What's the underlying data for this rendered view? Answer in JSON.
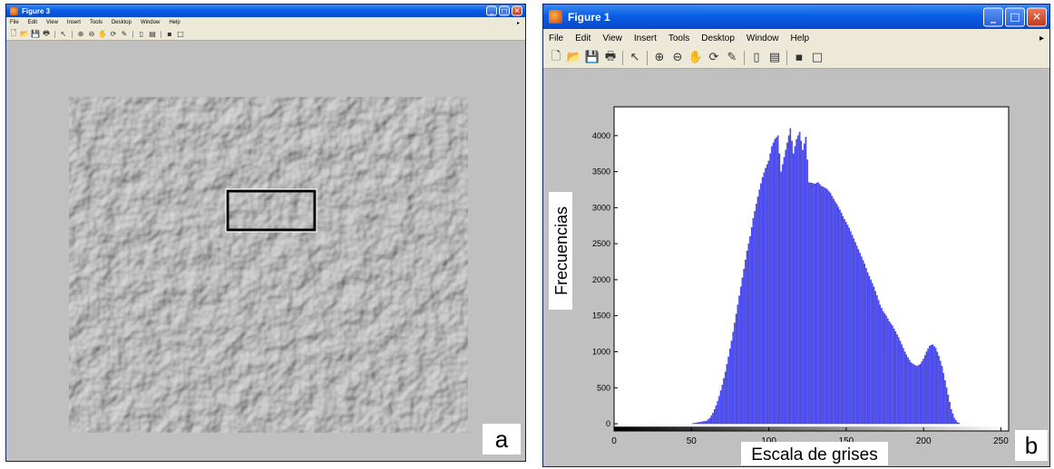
{
  "left_window": {
    "title": "Figure 3",
    "menu": [
      "File",
      "Edit",
      "View",
      "Insert",
      "Tools",
      "Desktop",
      "Window",
      "Help"
    ],
    "toolbar_icons": [
      "new-file-icon",
      "open-folder-icon",
      "save-icon",
      "print-icon",
      "pointer-icon",
      "zoom-in-icon",
      "zoom-out-icon",
      "pan-icon",
      "rotate-3d-icon",
      "data-cursor-icon",
      "colorbar-icon",
      "legend-icon",
      "hide-plot-tools-icon",
      "show-plot-tools-icon"
    ],
    "image": "grayscale leather texture",
    "panel_letter": "a"
  },
  "right_window": {
    "title": "Figure 1",
    "menu": [
      "File",
      "Edit",
      "View",
      "Insert",
      "Tools",
      "Desktop",
      "Window",
      "Help"
    ],
    "toolbar_icons": [
      "new-file-icon",
      "open-folder-icon",
      "save-icon",
      "print-icon",
      "pointer-icon",
      "zoom-in-icon",
      "zoom-out-icon",
      "pan-icon",
      "rotate-3d-icon",
      "data-cursor-icon",
      "colorbar-icon",
      "legend-icon",
      "hide-plot-tools-icon",
      "show-plot-tools-icon"
    ],
    "panel_letter": "b"
  },
  "colors": {
    "title_bar": "#0a5ee8",
    "figure_bg": "#c0c0c0",
    "bar_fill": "#5050ff"
  },
  "chart_data": {
    "type": "bar",
    "title": "",
    "xlabel": "Escala de grises",
    "ylabel": "Frecuencias",
    "xlim": [
      0,
      255
    ],
    "ylim": [
      -100,
      4400
    ],
    "xticks": [
      0,
      50,
      100,
      150,
      200,
      250
    ],
    "yticks": [
      0,
      500,
      1000,
      1500,
      2000,
      2500,
      3000,
      3500,
      4000
    ],
    "grid": false,
    "colorbar": "grayscale gradient 0 to 255 along x-axis",
    "series": [
      {
        "x": [
          0,
          10,
          20,
          30,
          40,
          50,
          55,
          60,
          62,
          64,
          66,
          68,
          70,
          72,
          74,
          76,
          78,
          80,
          82,
          84,
          86,
          88,
          90,
          92,
          94,
          96,
          98,
          100,
          102,
          104,
          106,
          108,
          110,
          112,
          114,
          116,
          118,
          120,
          122,
          124,
          126,
          128,
          130,
          132,
          134,
          136,
          138,
          140,
          142,
          144,
          146,
          148,
          150,
          152,
          154,
          156,
          158,
          160,
          162,
          164,
          166,
          168,
          170,
          172,
          174,
          176,
          178,
          180,
          182,
          184,
          186,
          188,
          190,
          192,
          194,
          196,
          198,
          200,
          202,
          204,
          206,
          208,
          210,
          212,
          214,
          216,
          218,
          220,
          222,
          224,
          226,
          230,
          240,
          250,
          255
        ],
        "values": [
          0,
          0,
          0,
          0,
          0,
          0,
          20,
          40,
          80,
          150,
          250,
          380,
          540,
          720,
          930,
          1150,
          1400,
          1650,
          1900,
          2150,
          2400,
          2600,
          2850,
          3050,
          3250,
          3420,
          3550,
          3650,
          3850,
          3950,
          4000,
          3500,
          3700,
          3900,
          4100,
          3750,
          3950,
          4050,
          3800,
          3980,
          3350,
          3340,
          3330,
          3350,
          3300,
          3280,
          3250,
          3200,
          3120,
          3050,
          2970,
          2880,
          2800,
          2720,
          2620,
          2520,
          2420,
          2320,
          2220,
          2100,
          2000,
          1900,
          1780,
          1650,
          1560,
          1500,
          1420,
          1360,
          1280,
          1200,
          1100,
          1000,
          920,
          850,
          820,
          800,
          830,
          900,
          1000,
          1080,
          1100,
          1050,
          940,
          800,
          600,
          400,
          200,
          80,
          20,
          0,
          0,
          0,
          0,
          0,
          0
        ]
      }
    ]
  }
}
